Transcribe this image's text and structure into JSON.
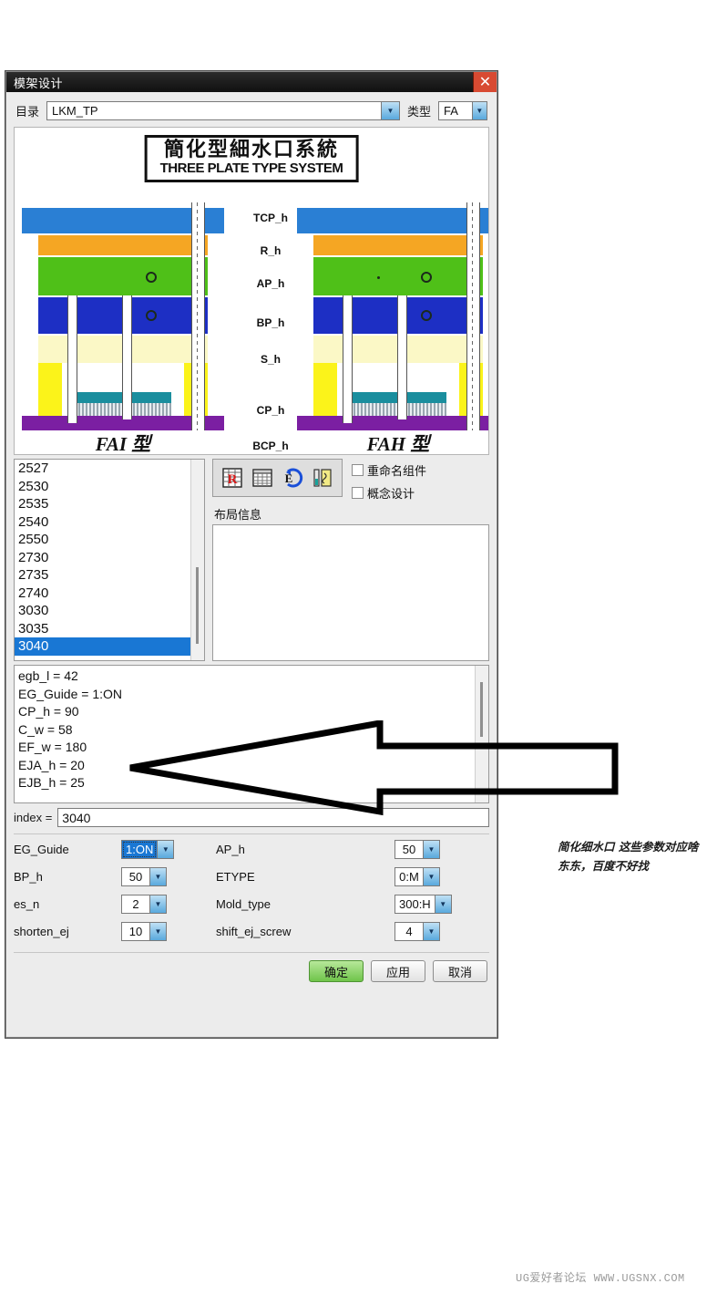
{
  "window": {
    "title": "模架设计",
    "close_label": "✕"
  },
  "directory": {
    "label": "目录",
    "value": "LKM_TP",
    "type_label": "类型",
    "type_value": "FA"
  },
  "diagram": {
    "title_cn": "簡化型細水口系統",
    "title_en": "THREE PLATE TYPE SYSTEM",
    "labels": [
      "TCP_h",
      "R_h",
      "AP_h",
      "BP_h",
      "S_h",
      "CP_h",
      "BCP_h"
    ],
    "left_caption": "FAI 型",
    "right_caption": "FAH 型"
  },
  "list": {
    "items": [
      "2527",
      "2530",
      "2535",
      "2540",
      "2550",
      "2730",
      "2735",
      "2740",
      "3030",
      "3035",
      "3040"
    ],
    "selected": "3040"
  },
  "toolbar": {
    "icons": [
      "table-r-icon",
      "grid-table-icon",
      "e-rotate-icon",
      "tool-pin-icon"
    ]
  },
  "checkboxes": [
    {
      "label": "重命名组件",
      "checked": false
    },
    {
      "label": "概念设计",
      "checked": false
    }
  ],
  "layout_info": {
    "label": "布局信息",
    "value": ""
  },
  "parameters": [
    "egb_l = 42",
    "EG_Guide = 1:ON",
    "CP_h = 90",
    "C_w = 58",
    "EF_w = 180",
    "EJA_h = 20",
    "EJB_h = 25"
  ],
  "index": {
    "label": "index =",
    "value": "3040"
  },
  "fields": [
    {
      "name": "EG_Guide",
      "value": "1:ON",
      "focused": true
    },
    {
      "name": "AP_h",
      "value": "50",
      "focused": false
    },
    {
      "name": "BP_h",
      "value": "50",
      "focused": false
    },
    {
      "name": "ETYPE",
      "value": "0:M",
      "focused": false
    },
    {
      "name": "es_n",
      "value": "2",
      "focused": false
    },
    {
      "name": "Mold_type",
      "value": "300:H",
      "focused": false
    },
    {
      "name": "shorten_ej",
      "value": "10",
      "focused": false
    },
    {
      "name": "shift_ej_screw",
      "value": "4",
      "focused": false
    }
  ],
  "buttons": {
    "ok": "确定",
    "apply": "应用",
    "cancel": "取消"
  },
  "annotation": {
    "note": "简化细水口 这些参数对应啥东东，百度不好找"
  },
  "footer": {
    "watermark": "UG爱好者论坛 WWW.UGSNX.COM"
  }
}
